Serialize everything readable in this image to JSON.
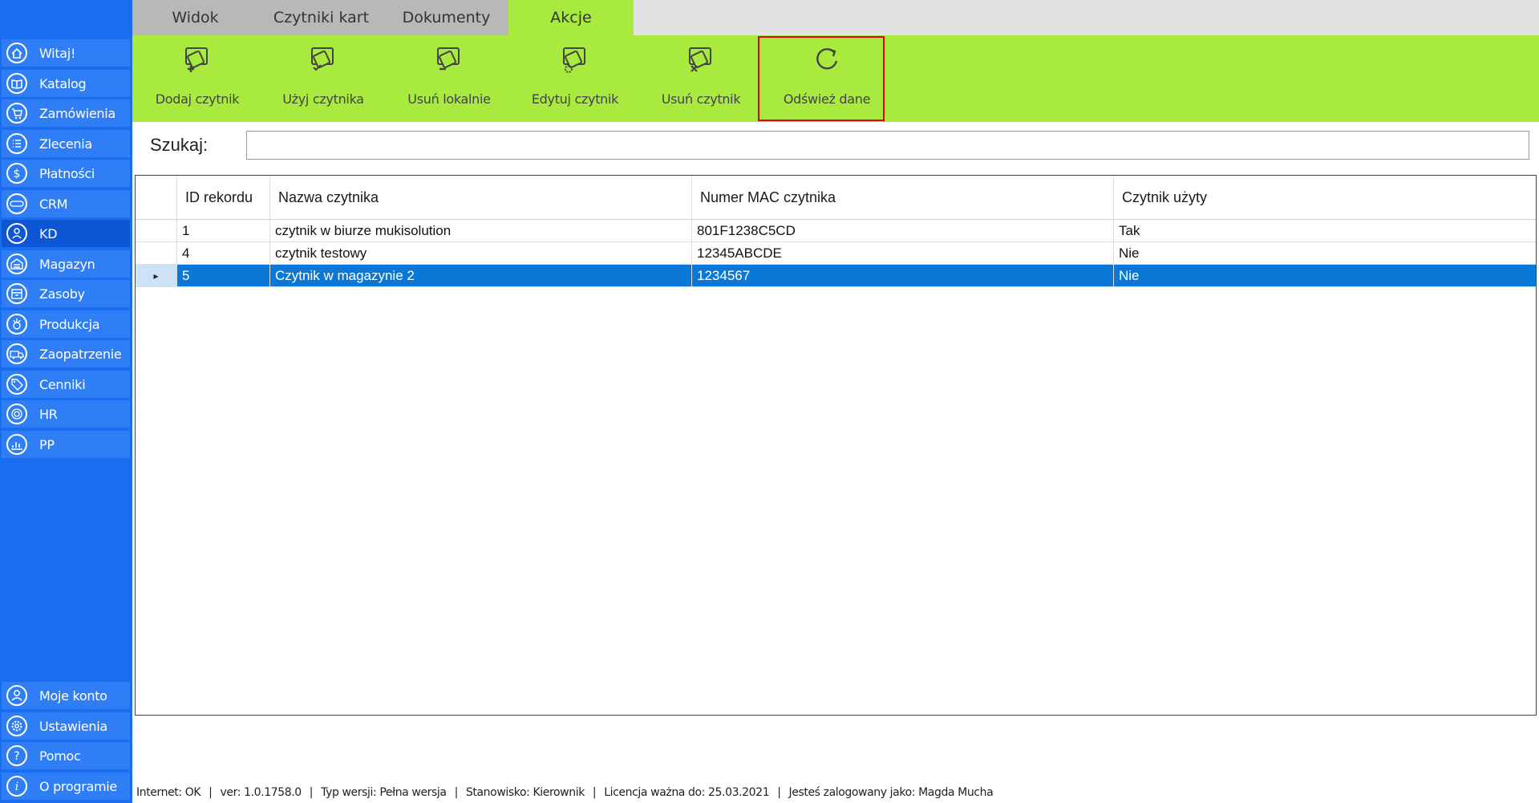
{
  "tabs": [
    {
      "label": "Widok",
      "active": false
    },
    {
      "label": "Czytniki kart",
      "active": false
    },
    {
      "label": "Dokumenty",
      "active": false
    },
    {
      "label": "Akcje",
      "active": true
    }
  ],
  "ribbon": {
    "buttons": [
      {
        "label": "Dodaj czytnik",
        "icon": "reader-add-icon"
      },
      {
        "label": "Użyj czytnika",
        "icon": "reader-use-icon"
      },
      {
        "label": "Usuń lokalnie",
        "icon": "reader-remove-local-icon"
      },
      {
        "label": "Edytuj czytnik",
        "icon": "reader-edit-icon"
      },
      {
        "label": "Usuń czytnik",
        "icon": "reader-delete-icon"
      },
      {
        "label": "Odśwież dane",
        "icon": "refresh-icon",
        "highlighted": true
      }
    ]
  },
  "sidebar": {
    "items": [
      {
        "label": "Witaj!",
        "icon": "home-icon"
      },
      {
        "label": "Katalog",
        "icon": "book-icon"
      },
      {
        "label": "Zamówienia",
        "icon": "cart-icon"
      },
      {
        "label": "Zlecenia",
        "icon": "list-icon"
      },
      {
        "label": "Płatności",
        "icon": "dollar-icon"
      },
      {
        "label": "CRM",
        "icon": "crm-icon"
      },
      {
        "label": "KD",
        "icon": "user-badge-icon",
        "active": true
      },
      {
        "label": "Magazyn",
        "icon": "warehouse-icon"
      },
      {
        "label": "Zasoby",
        "icon": "resources-icon"
      },
      {
        "label": "Produkcja",
        "icon": "production-icon"
      },
      {
        "label": "Zaopatrzenie",
        "icon": "truck-icon"
      },
      {
        "label": "Cenniki",
        "icon": "tag-icon"
      },
      {
        "label": "HR",
        "icon": "fingerprint-icon"
      },
      {
        "label": "PP",
        "icon": "chart-hand-icon"
      }
    ],
    "bottom_items": [
      {
        "label": "Moje konto",
        "icon": "account-icon"
      },
      {
        "label": "Ustawienia",
        "icon": "gear-icon"
      },
      {
        "label": "Pomoc",
        "icon": "help-icon"
      },
      {
        "label": "O programie",
        "icon": "info-icon"
      }
    ]
  },
  "search": {
    "label": "Szukaj:",
    "value": ""
  },
  "table": {
    "columns": {
      "id": "ID rekordu",
      "name": "Nazwa czytnika",
      "mac": "Numer MAC czytnika",
      "used": "Czytnik użyty"
    },
    "rows": [
      {
        "id": "1",
        "name": "czytnik w biurze mukisolution",
        "mac": "801F1238C5CD",
        "used": "Tak"
      },
      {
        "id": "4",
        "name": "czytnik testowy",
        "mac": "12345ABCDE",
        "used": "Nie"
      },
      {
        "id": "5",
        "name": "Czytnik w magazynie 2",
        "mac": "1234567",
        "used": "Nie",
        "selected": true
      }
    ],
    "row_indicator": "▸"
  },
  "status_bar": {
    "internet": "Internet: OK",
    "version": "ver: 1.0.1758.0",
    "type": "Typ wersji: Pełna wersja",
    "position": "Stanowisko: Kierownik",
    "license": "Licencja ważna do: 25.03.2021",
    "user": "Jesteś zalogowany jako: Magda Mucha",
    "separator": "|"
  },
  "colors": {
    "sidebar": "#1a6cf0",
    "sidebar_item": "#2f7ef5",
    "ribbon": "#a9ea3f",
    "selection": "#0a78d7",
    "highlight_border": "#e60000"
  }
}
